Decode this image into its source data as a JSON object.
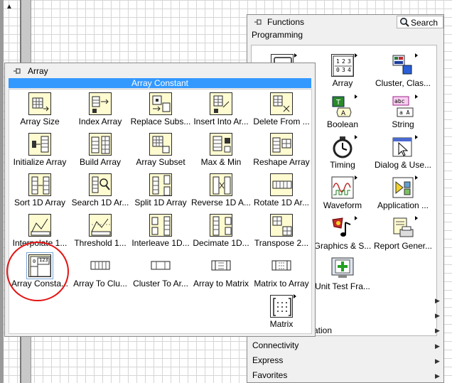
{
  "functions_palette": {
    "title": "Functions",
    "search_label": "Search",
    "category": "Programming",
    "items": [
      {
        "label": "",
        "icon": "structures-icon"
      },
      {
        "label": "Array",
        "icon": "array-icon"
      },
      {
        "label": "Cluster, Clas...",
        "icon": "cluster-class-icon"
      },
      {
        "label": "Boolean",
        "icon": "boolean-icon"
      },
      {
        "label": "String",
        "icon": "string-icon"
      },
      {
        "label": "Timing",
        "icon": "timing-icon"
      },
      {
        "label": "Dialog & Use...",
        "icon": "dialog-icon"
      },
      {
        "label": "Waveform",
        "icon": "waveform-icon"
      },
      {
        "label": "Application ...",
        "icon": "application-icon"
      },
      {
        "label": "Graphics & S...",
        "icon": "graphics-sound-icon"
      },
      {
        "label": "Report Gener...",
        "icon": "report-generation-icon"
      },
      {
        "label": "Unit Test Fra...",
        "icon": "unit-test-icon"
      }
    ],
    "bottom_categories": [
      "",
      "ation",
      "Connectivity",
      "Express",
      "Favorites"
    ]
  },
  "array_palette": {
    "title": "Array",
    "highlighted_item": "Array Constant",
    "items": [
      {
        "label": "Array Size",
        "icon": "array-size-icon"
      },
      {
        "label": "Index Array",
        "icon": "index-array-icon"
      },
      {
        "label": "Replace Subs...",
        "icon": "replace-subset-icon"
      },
      {
        "label": "Insert Into Ar...",
        "icon": "insert-into-array-icon"
      },
      {
        "label": "Delete From ...",
        "icon": "delete-from-array-icon"
      },
      {
        "label": "Initialize Array",
        "icon": "initialize-array-icon"
      },
      {
        "label": "Build Array",
        "icon": "build-array-icon"
      },
      {
        "label": "Array Subset",
        "icon": "array-subset-icon"
      },
      {
        "label": "Max & Min",
        "icon": "max-min-icon"
      },
      {
        "label": "Reshape Array",
        "icon": "reshape-array-icon"
      },
      {
        "label": "Sort 1D Array",
        "icon": "sort-1d-array-icon"
      },
      {
        "label": "Search 1D Ar...",
        "icon": "search-1d-array-icon"
      },
      {
        "label": "Split 1D Array",
        "icon": "split-1d-array-icon"
      },
      {
        "label": "Reverse 1D A...",
        "icon": "reverse-1d-array-icon"
      },
      {
        "label": "Rotate 1D Ar...",
        "icon": "rotate-1d-array-icon"
      },
      {
        "label": "Interpolate 1...",
        "icon": "interpolate-1d-array-icon"
      },
      {
        "label": "Threshold 1...",
        "icon": "threshold-1d-array-icon"
      },
      {
        "label": "Interleave 1D...",
        "icon": "interleave-1d-arrays-icon"
      },
      {
        "label": "Decimate 1D...",
        "icon": "decimate-1d-array-icon"
      },
      {
        "label": "Transpose 2...",
        "icon": "transpose-2d-array-icon"
      },
      {
        "label": "Array Consta...",
        "icon": "array-constant-icon"
      },
      {
        "label": "Array To Clu...",
        "icon": "array-to-cluster-icon"
      },
      {
        "label": "Cluster To Ar...",
        "icon": "cluster-to-array-icon"
      },
      {
        "label": "Array to Matrix",
        "icon": "array-to-matrix-icon"
      },
      {
        "label": "Matrix to Array",
        "icon": "matrix-to-array-icon"
      },
      {
        "label": "Matrix",
        "icon": "matrix-icon"
      }
    ],
    "array_constant_glyph": "123"
  },
  "colors": {
    "highlight": "#3399ff",
    "annotation_circle": "#e31414",
    "icon_fill": "#fffbd0"
  }
}
